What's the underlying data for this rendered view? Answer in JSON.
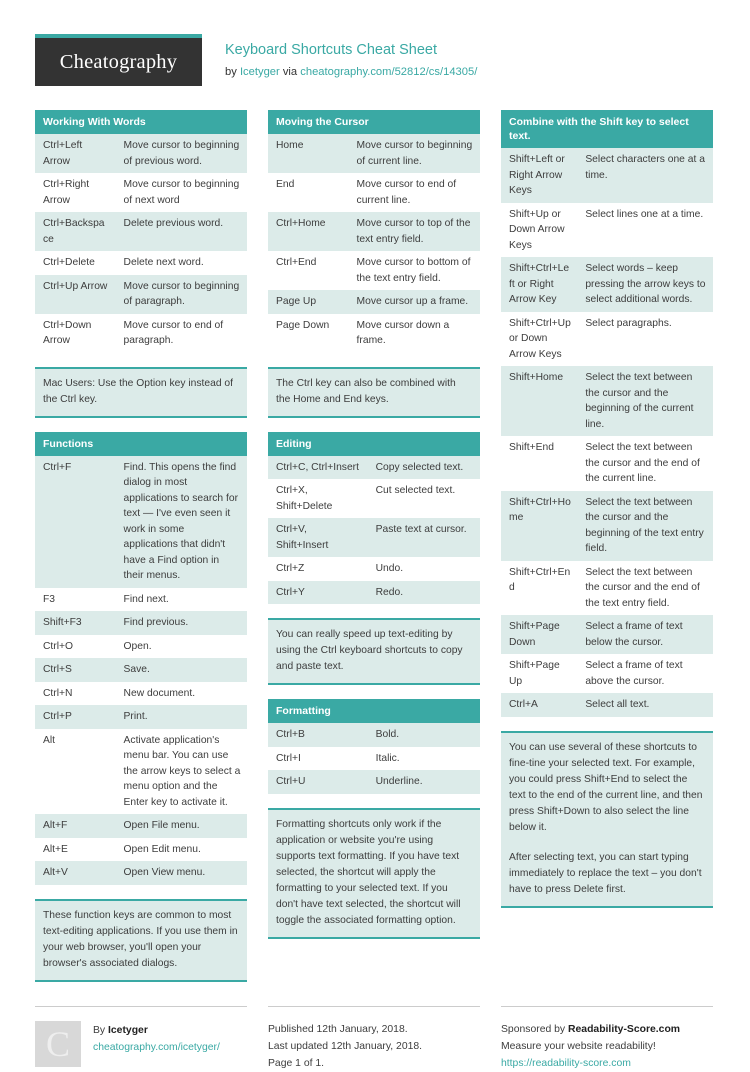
{
  "header": {
    "logo": "Cheatography",
    "title": "Keyboard Shortcuts Cheat Sheet",
    "by_prefix": "by ",
    "author": "Icetyger",
    "via": " via ",
    "source_url": "cheatography.com/52812/cs/14305/"
  },
  "colors": {
    "accent": "#3aa9a4",
    "row_tint": "#dcebe9",
    "logo_bg": "#333333"
  },
  "columns": [
    {
      "blocks": [
        {
          "type": "table",
          "title": "Working With Words",
          "rows": [
            {
              "key": "Ctrl+Left Arrow",
              "value": "Move cursor to beginning of previous word."
            },
            {
              "key": "Ctrl+Right Arrow",
              "value": "Move cursor to beginning of next word"
            },
            {
              "key": "Ctrl+Backspace",
              "value": "Delete previous word."
            },
            {
              "key": "Ctrl+Delete",
              "value": "Delete next word."
            },
            {
              "key": "Ctrl+Up Arrow",
              "value": "Move cursor to beginning of paragraph."
            },
            {
              "key": "Ctrl+Down Arrow",
              "value": "Move cursor to end of paragraph."
            }
          ]
        },
        {
          "type": "note",
          "paragraphs": [
            "Mac Users: Use the Option key instead of the Ctrl key."
          ]
        },
        {
          "type": "table",
          "title": "Functions",
          "rows": [
            {
              "key": "Ctrl+F",
              "value": "Find. This opens the find dialog in most applications to search for text — I've even seen it work in some applications that didn't have a Find option in their menus."
            },
            {
              "key": "F3",
              "value": "Find next."
            },
            {
              "key": "Shift+F3",
              "value": "Find previous."
            },
            {
              "key": "Ctrl+O",
              "value": "Open."
            },
            {
              "key": "Ctrl+S",
              "value": "Save."
            },
            {
              "key": "Ctrl+N",
              "value": "New document."
            },
            {
              "key": "Ctrl+P",
              "value": "Print."
            },
            {
              "key": "Alt",
              "value": "Activate application's menu bar. You can use the arrow keys to select a menu option and the Enter key to activate it."
            },
            {
              "key": "Alt+F",
              "value": "Open File menu."
            },
            {
              "key": "Alt+E",
              "value": "Open Edit menu."
            },
            {
              "key": "Alt+V",
              "value": "Open View menu."
            }
          ]
        },
        {
          "type": "note",
          "paragraphs": [
            "These function keys are common to most text-editing applications. If you use them in your web browser, you'll open your browser's associated dialogs."
          ]
        }
      ]
    },
    {
      "blocks": [
        {
          "type": "table",
          "title": "Moving the Cursor",
          "rows": [
            {
              "key": "Home",
              "value": "Move cursor to beginning of current line."
            },
            {
              "key": "End",
              "value": "Move cursor to end of current line."
            },
            {
              "key": "Ctrl+Home",
              "value": "Move cursor to top of the text entry field."
            },
            {
              "key": "Ctrl+End",
              "value": "Move cursor to bottom of the text entry field."
            },
            {
              "key": "Page Up",
              "value": "Move cursor up a frame."
            },
            {
              "key": "Page Down",
              "value": "Move cursor down a frame."
            }
          ]
        },
        {
          "type": "note",
          "paragraphs": [
            "The Ctrl key can also be combined with the Home and End keys."
          ]
        },
        {
          "type": "table",
          "title": "Editing",
          "wide_key": true,
          "rows": [
            {
              "key": "Ctrl+C, Ctrl+Insert",
              "value": "Copy selected text."
            },
            {
              "key": "Ctrl+X, Shift+Delete",
              "value": "Cut selected text."
            },
            {
              "key": "Ctrl+V, Shift+Insert",
              "value": "Paste text at cursor."
            },
            {
              "key": "Ctrl+Z",
              "value": "Undo."
            },
            {
              "key": "Ctrl+Y",
              "value": "Redo."
            }
          ]
        },
        {
          "type": "note",
          "paragraphs": [
            "You can really speed up text-editing by using the Ctrl keyboard shortcuts to copy and paste text."
          ]
        },
        {
          "type": "table",
          "title": "Formatting",
          "wide_key": true,
          "rows": [
            {
              "key": "Ctrl+B",
              "value": "Bold."
            },
            {
              "key": "Ctrl+I",
              "value": "Italic."
            },
            {
              "key": "Ctrl+U",
              "value": "Underline."
            }
          ]
        },
        {
          "type": "note",
          "paragraphs": [
            "Formatting shortcuts only work if the application or website you're using supports text formatting. If you have text selected, the shortcut will apply the formatting to your selected text. If you don't have text selected, the shortcut will toggle the associated formatting option."
          ]
        }
      ]
    },
    {
      "blocks": [
        {
          "type": "table",
          "title": "Combine with the Shift key to select text.",
          "narrow_key": true,
          "rows": [
            {
              "key": "Shift+Left or Right Arrow Keys",
              "value": "Select characters one at a time."
            },
            {
              "key": "Shift+Up or Down Arrow Keys",
              "value": "Select lines one at a time."
            },
            {
              "key": "Shift+Ctrl+Left or Right Arrow Key",
              "value": "Select words – keep pressing the arrow keys to select additional words."
            },
            {
              "key": "Shift+Ctrl+Up or Down Arrow Keys",
              "value": "Select paragraphs."
            },
            {
              "key": "Shift+Home",
              "value": "Select the text between the cursor and the beginning of the current line."
            },
            {
              "key": "Shift+End",
              "value": "Select the text between the cursor and the end of the current line."
            },
            {
              "key": "Shift+Ctrl+Home",
              "value": "Select the text between the cursor and the beginning of the text entry field."
            },
            {
              "key": "Shift+Ctrl+End",
              "value": "Select the text between the cursor and the end of the text entry field."
            },
            {
              "key": "Shift+Page Down",
              "value": "Select a frame of text below the cursor."
            },
            {
              "key": "Shift+Page Up",
              "value": "Select a frame of text above the cursor."
            },
            {
              "key": "Ctrl+A",
              "value": "Select all text."
            }
          ]
        },
        {
          "type": "note",
          "paragraphs": [
            "You can use several of these shortcuts to fine-tine your selected text. For example, you could press Shift+End to select the text to the end of the current line, and then press Shift+Down to also select the line below it.",
            "After selecting text, you can start typing immediately to replace the text – you don't have to press Delete first."
          ]
        }
      ]
    }
  ],
  "footer": {
    "avatar_letter": "C",
    "by_label": "By ",
    "author": "Icetyger",
    "author_url": "cheatography.com/icetyger/",
    "published": "Published 12th January, 2018.",
    "updated": "Last updated 12th January, 2018.",
    "page": "Page 1 of 1.",
    "sponsor_prefix": "Sponsored by ",
    "sponsor_name": "Readability-Score.com",
    "sponsor_tagline": "Measure your website readability!",
    "sponsor_url": "https://readability-score.com"
  }
}
